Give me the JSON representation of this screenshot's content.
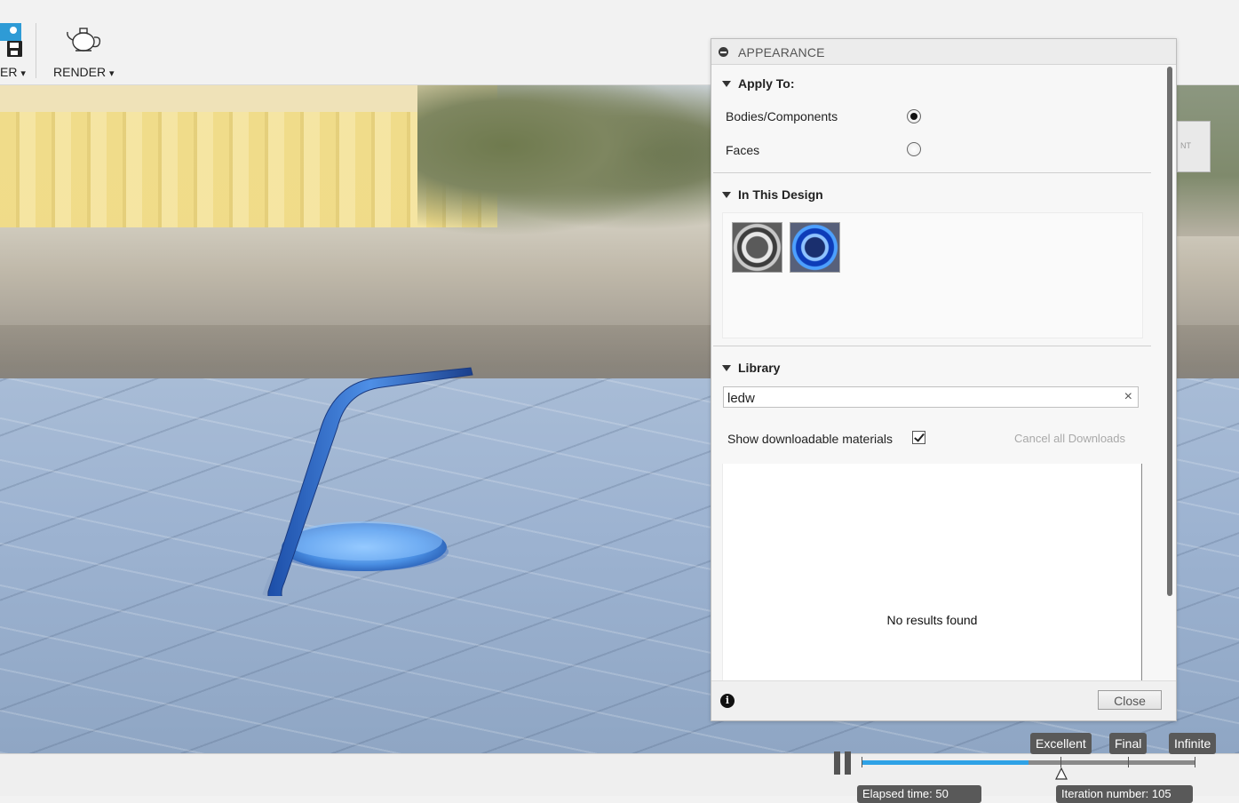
{
  "toolbar": {
    "partial_label": "ER",
    "render_label": "RENDER",
    "dropdown_glyph": "▾",
    "icons": [
      "save-icon",
      "teapot-icon"
    ]
  },
  "viewport": {
    "cube_text": "NT",
    "scene": "rendered-lamp-model"
  },
  "render_quality": {
    "labels": [
      "Excellent",
      "Final",
      "Infinite"
    ],
    "progress": 0.5,
    "elapsed_label": "Elapsed time: 50",
    "iteration_label": "Iteration number: 105",
    "accent_color": "#2fa2e6"
  },
  "appearance_panel": {
    "title": "APPEARANCE",
    "apply_to": {
      "heading": "Apply To:",
      "options": [
        {
          "label": "Bodies/Components",
          "checked": true
        },
        {
          "label": "Faces",
          "checked": false
        }
      ]
    },
    "in_this_design": {
      "heading": "In This Design",
      "swatches": [
        "gray-metal-swatch",
        "blue-glass-swatch"
      ]
    },
    "library": {
      "heading": "Library",
      "search_value": "ledw",
      "clear_glyph": "×",
      "show_downloadable_label": "Show downloadable materials",
      "show_downloadable_checked": true,
      "cancel_downloads_label": "Cancel all Downloads",
      "no_results_text": "No results found"
    },
    "footer": {
      "info_glyph": "i",
      "close_label": "Close"
    }
  }
}
